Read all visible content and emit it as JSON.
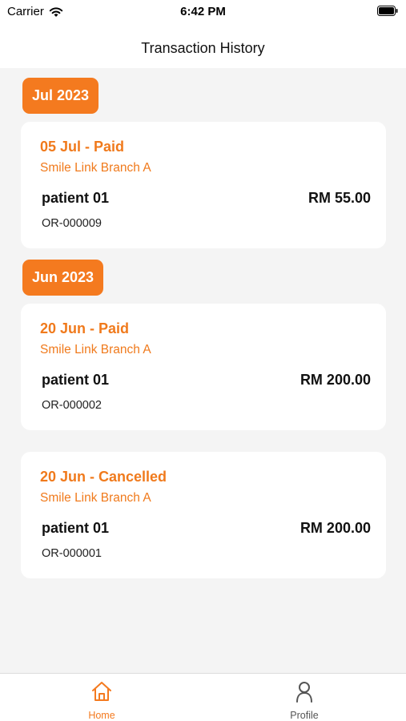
{
  "status_bar": {
    "carrier": "Carrier",
    "time": "6:42 PM"
  },
  "nav": {
    "title": "Transaction History"
  },
  "groups": [
    {
      "month": "Jul 2023",
      "transactions": [
        {
          "title": "05 Jul - Paid",
          "branch": "Smile Link Branch A",
          "patient": "patient 01",
          "amount": "RM 55.00",
          "ref": "OR-000009"
        }
      ]
    },
    {
      "month": "Jun 2023",
      "transactions": [
        {
          "title": "20 Jun - Paid",
          "branch": "Smile Link Branch A",
          "patient": "patient 01",
          "amount": "RM 200.00",
          "ref": "OR-000002"
        },
        {
          "title": "20 Jun - Cancelled",
          "branch": "Smile Link Branch A",
          "patient": "patient 01",
          "amount": "RM 200.00",
          "ref": "OR-000001"
        }
      ]
    }
  ],
  "tab_bar": {
    "home_label": "Home",
    "profile_label": "Profile",
    "home_icon": "home-icon",
    "profile_icon": "person-icon"
  },
  "colors": {
    "accent": "#f47a1f",
    "background": "#f4f4f4",
    "inactive_tab": "#555555"
  }
}
